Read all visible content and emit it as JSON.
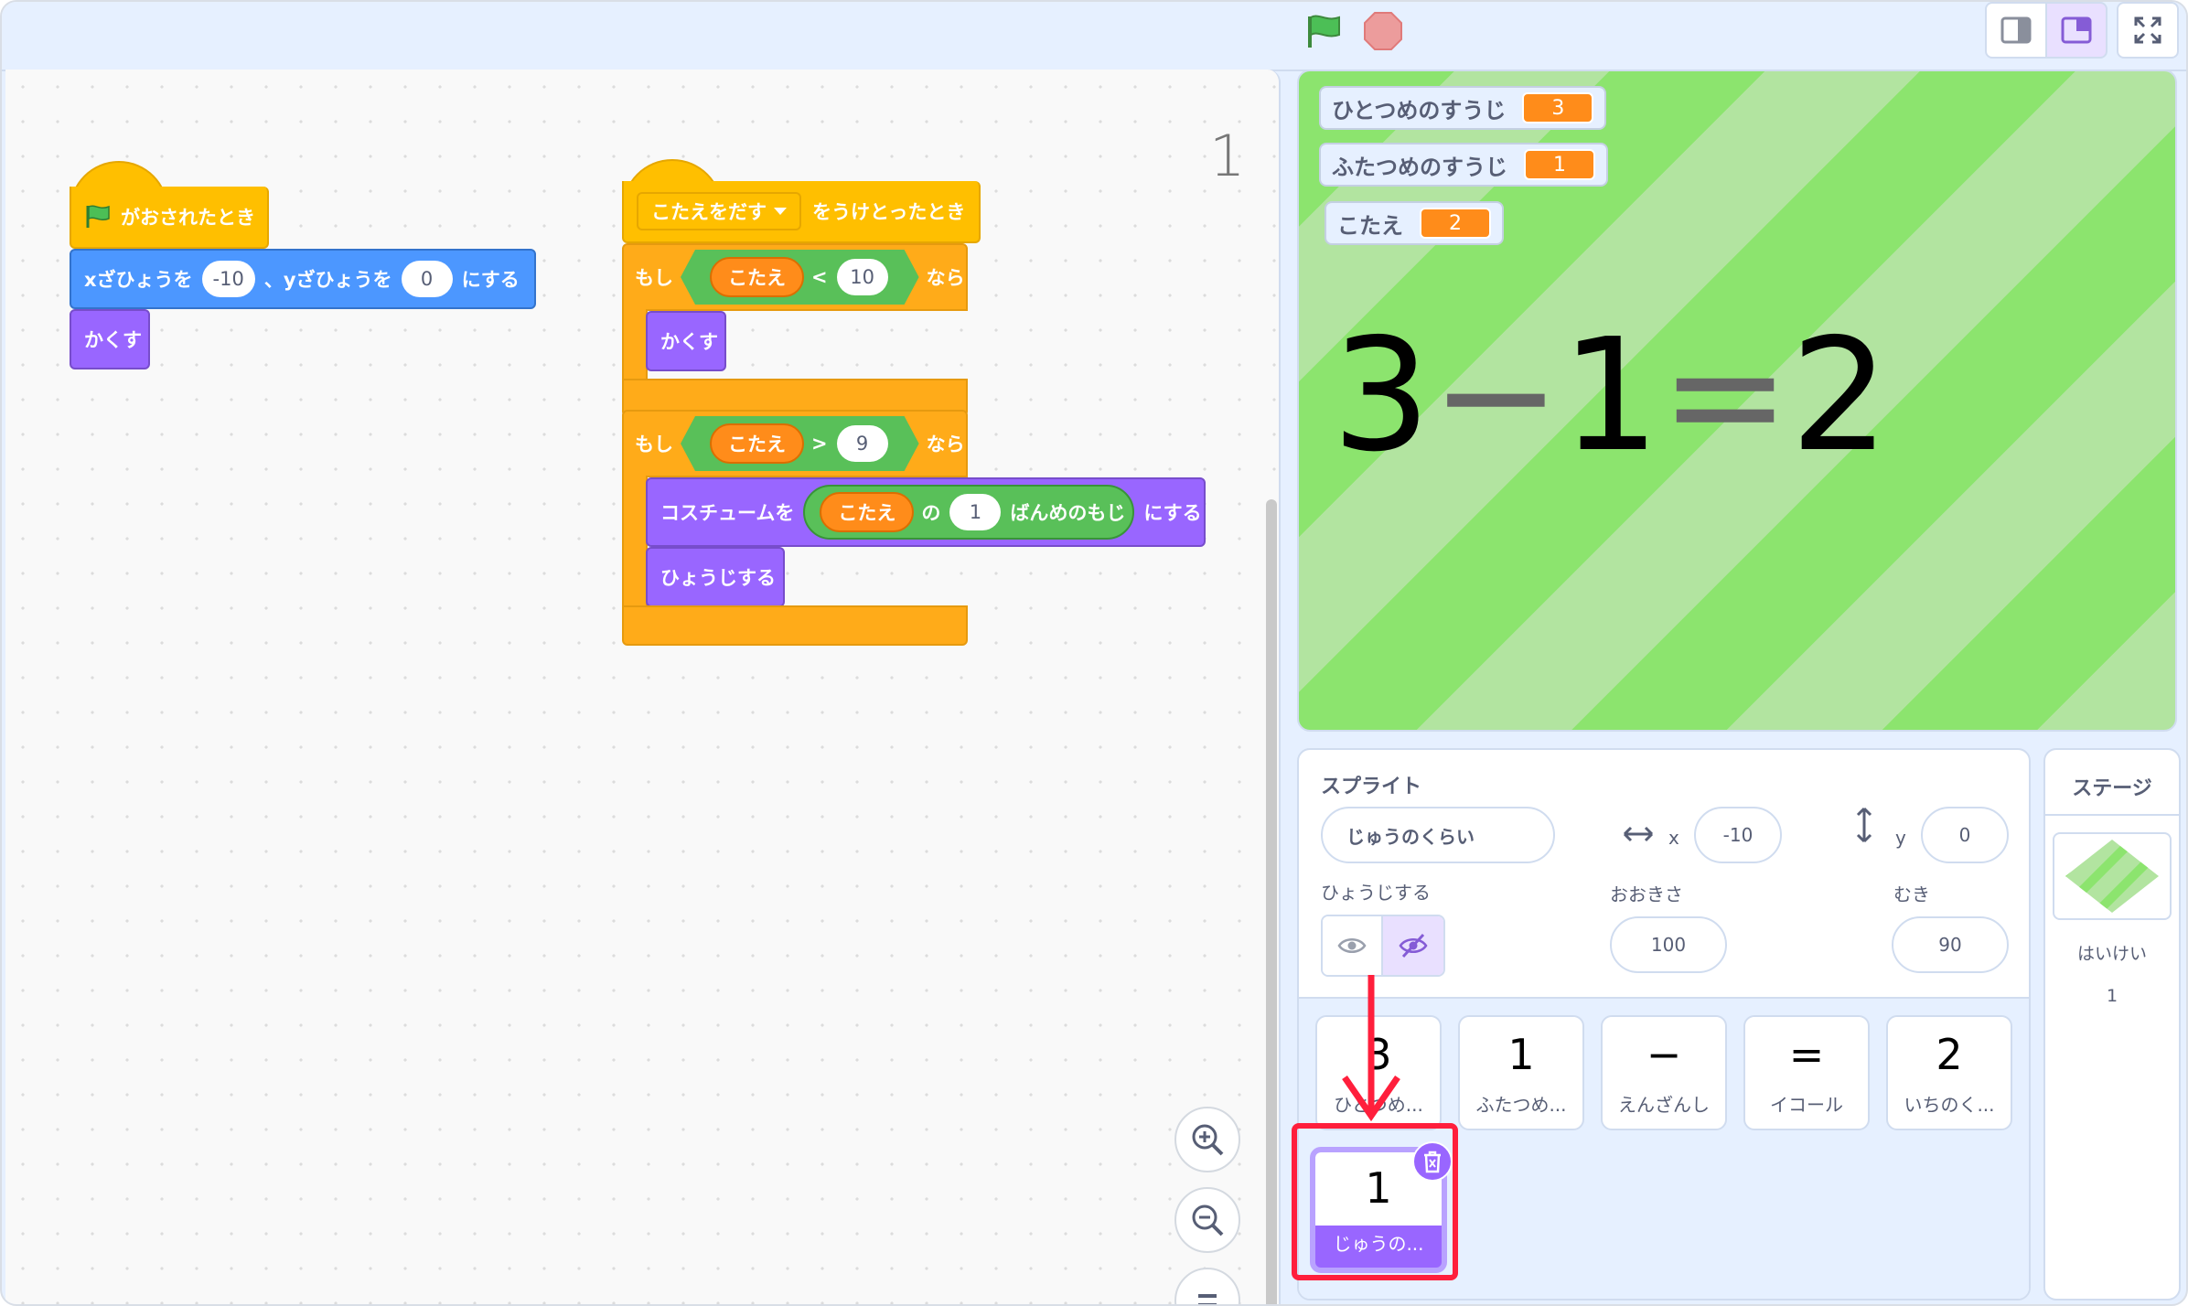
{
  "toolbar": {
    "flag_icon": "green-flag-icon",
    "stop_icon": "stop-icon",
    "layout_buttons": [
      "small-stage-icon",
      "normal-stage-icon",
      "fullscreen-icon"
    ]
  },
  "code": {
    "sprite_number": "1",
    "script1": {
      "hat": "がおされたとき",
      "goto_a": "xざひょうを",
      "goto_x": "-10",
      "goto_b": "、yざひょうを",
      "goto_y": "0",
      "goto_c": "にする",
      "hide": "かくす"
    },
    "script2": {
      "dropdown": "こたえをだす",
      "hat_suffix": "をうけとったとき",
      "if": "もし",
      "then": "なら",
      "answer": "こたえ",
      "lt": "<",
      "lt_value": "10",
      "hide": "かくす",
      "gt": ">",
      "gt_value": "9",
      "costume_a": "コスチュームを",
      "of": "の",
      "letter_index": "1",
      "letter_suffix": "ばんめのもじ",
      "costume_b": "にする",
      "show": "ひょうじする"
    }
  },
  "stage": {
    "monitors": [
      {
        "label": "ひとつめのすうじ",
        "value": "3"
      },
      {
        "label": "ふたつめのすうじ",
        "value": "1"
      },
      {
        "label": "こたえ",
        "value": "2"
      }
    ],
    "equation": {
      "a": "3",
      "op": "−",
      "b": "1",
      "eq": "=",
      "c": "2"
    }
  },
  "sprite_info": {
    "title": "スプライト",
    "name": "じゅうのくらい",
    "x_label": "x",
    "x_value": "-10",
    "y_label": "y",
    "y_value": "0",
    "show_label": "ひょうじする",
    "size_label": "おおきさ",
    "size_value": "100",
    "direction_label": "むき",
    "direction_value": "90"
  },
  "sprites": [
    {
      "costume": "3",
      "name": "ひとつめ..."
    },
    {
      "costume": "1",
      "name": "ふたつめ..."
    },
    {
      "costume": "−",
      "name": "えんざんし"
    },
    {
      "costume": "=",
      "name": "イコール"
    },
    {
      "costume": "2",
      "name": "いちのく..."
    },
    {
      "costume": "1",
      "name": "じゅうの..."
    }
  ],
  "stage_pane": {
    "title": "ステージ",
    "backdrop_label": "はいけい",
    "backdrop_count": "1"
  },
  "colors": {
    "events": "#ffbf00",
    "control": "#ffab19",
    "motion": "#4c97ff",
    "looks": "#9966ff",
    "operators": "#59c059",
    "sensing": "#ff8c1a",
    "highlight": "#ff1f3c"
  }
}
